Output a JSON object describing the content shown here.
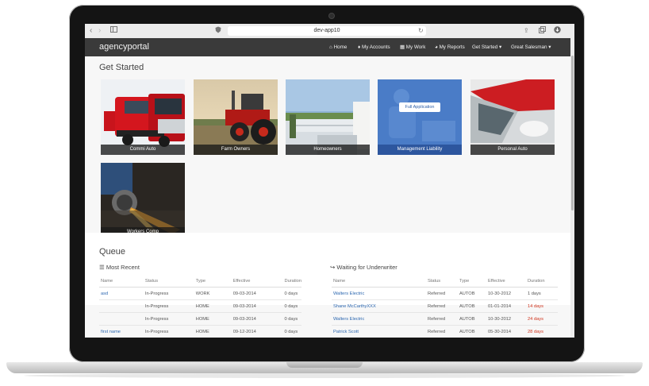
{
  "browser": {
    "url": "dev-app10"
  },
  "navbar": {
    "brand": "agencyportal",
    "items": [
      "Home",
      "My Accounts",
      "My Work",
      "My Reports",
      "Get Started",
      "Great Salesman"
    ]
  },
  "get_started": {
    "title": "Get Started",
    "tiles": [
      "Commi Auto",
      "Farm Owners",
      "Homeowners",
      "Management Liability",
      "Personal Auto",
      "Workers Comp"
    ],
    "full_application": "Full Application"
  },
  "queue": {
    "title": "Queue",
    "most_recent": {
      "title": "Most Recent",
      "headers": [
        "Name",
        "Status",
        "Type",
        "Effective",
        "Duration"
      ],
      "rows": [
        [
          "asd",
          "In-Progress",
          "WORK",
          "09-03-2014",
          "0 days"
        ],
        [
          "",
          "In-Progress",
          "HOME",
          "09-03-2014",
          "0 days"
        ],
        [
          "",
          "In-Progress",
          "HOME",
          "09-03-2014",
          "0 days"
        ],
        [
          "first name",
          "In-Progress",
          "HOME",
          "09-12-2014",
          "0 days"
        ]
      ]
    },
    "waiting": {
      "title": "Waiting for Underwriter",
      "headers": [
        "Name",
        "Status",
        "Type",
        "Effective",
        "Duration"
      ],
      "rows": [
        [
          "Walters Electric",
          "Referred",
          "AUTOB",
          "10-30-2012",
          "1 days"
        ],
        [
          "Shane McCarthyXXX",
          "Referred",
          "AUTOB",
          "01-01-2014",
          "14 days"
        ],
        [
          "Walters Electric",
          "Referred",
          "AUTOB",
          "10-30-2012",
          "24 days"
        ],
        [
          "Patrick Scott",
          "Referred",
          "AUTOB",
          "05-30-2014",
          "28 days"
        ]
      ]
    }
  },
  "colors": {
    "navbar": "#3a3a3a",
    "link": "#2d68b0",
    "overdue": "#d0331c",
    "management_tile": "#3f72c0"
  }
}
